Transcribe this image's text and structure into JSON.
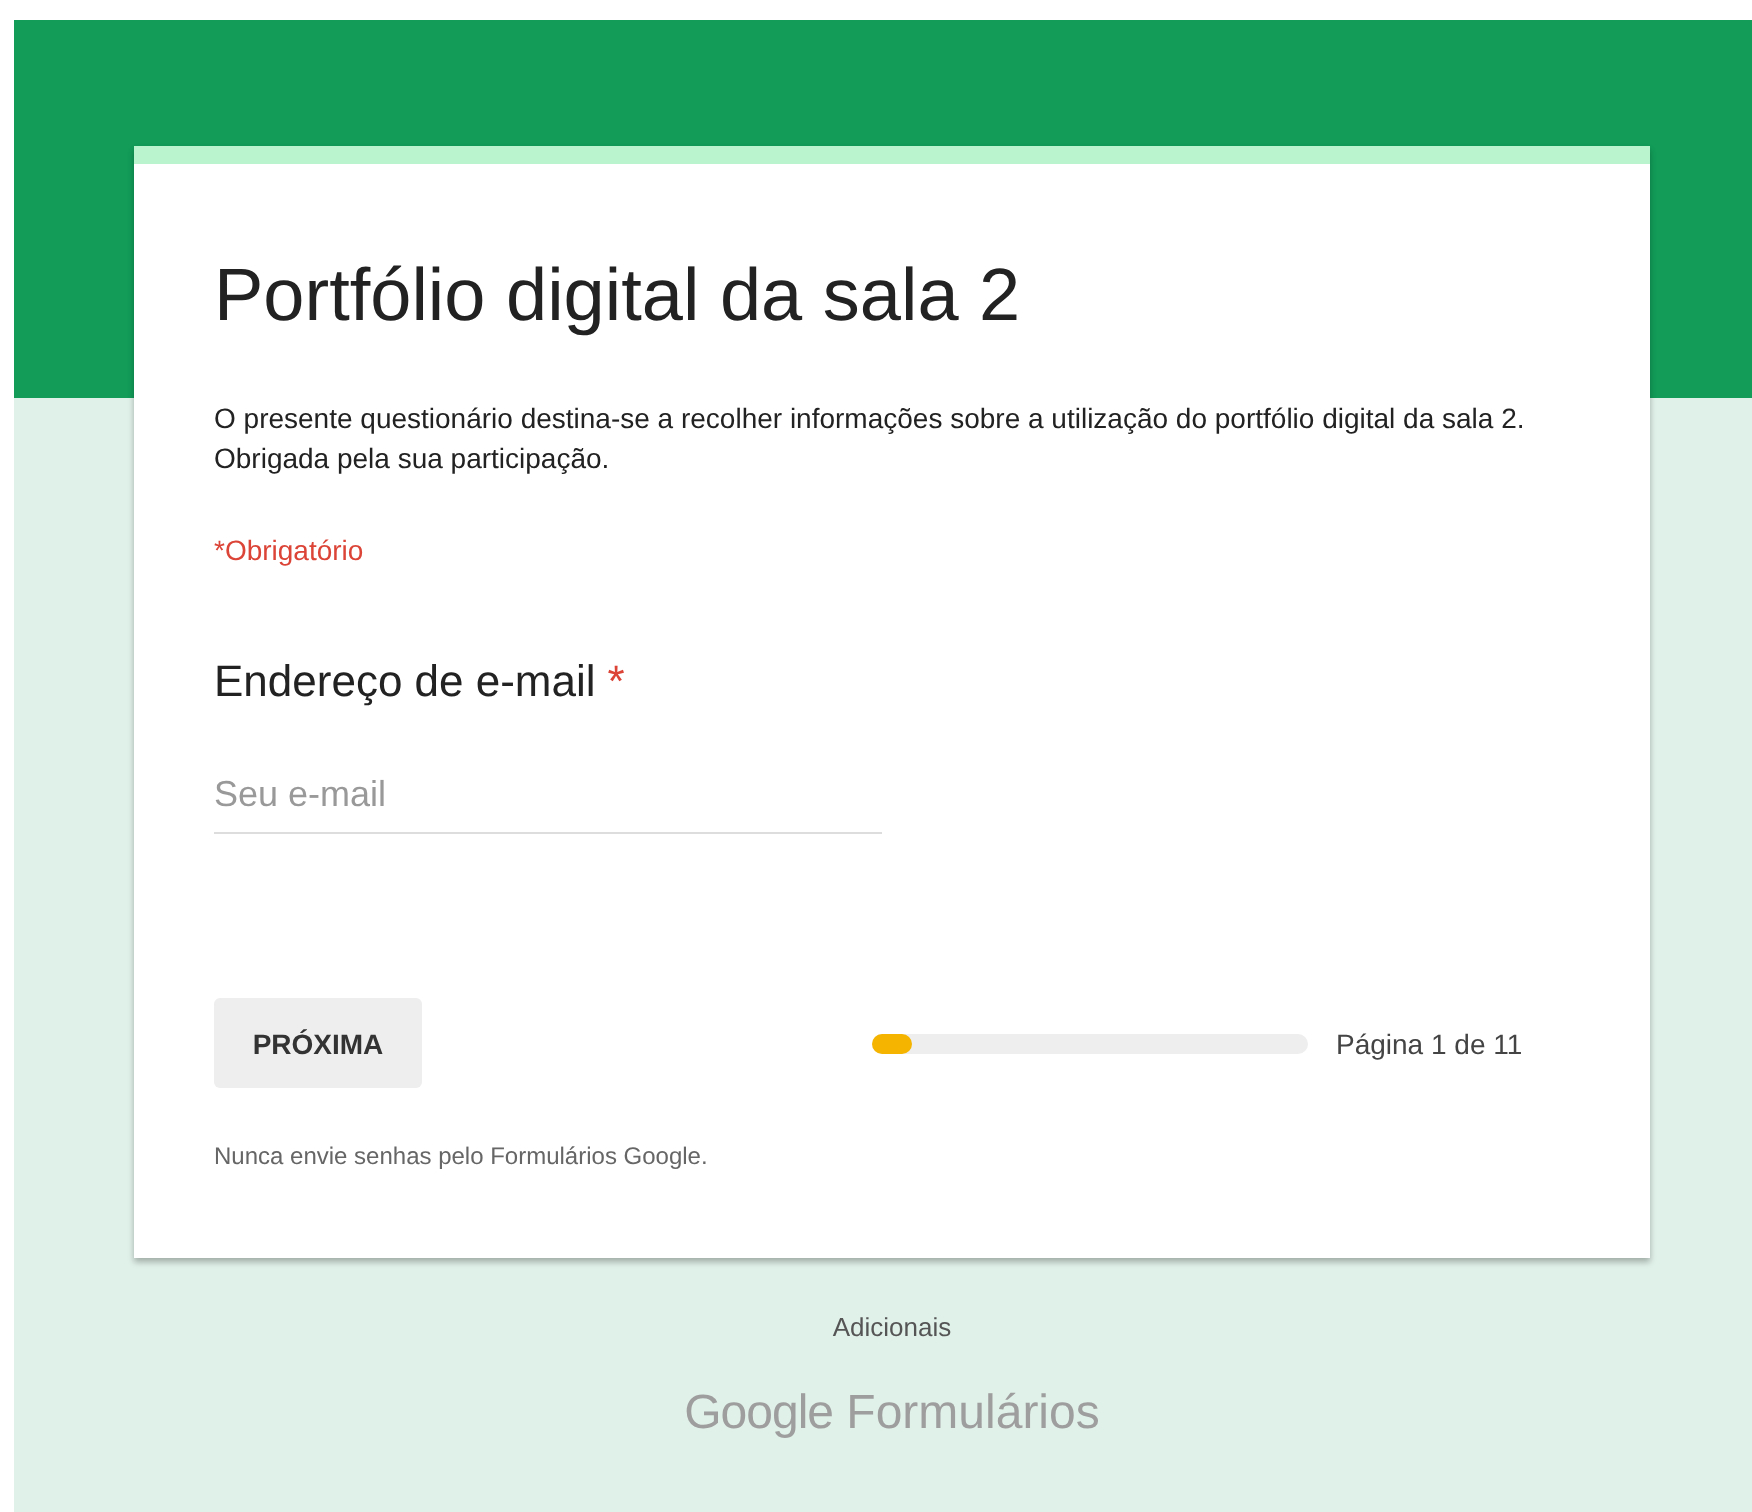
{
  "form": {
    "title": "Portfólio digital da sala 2",
    "description": "O presente questionário destina-se a recolher informações sobre a utilização do portfólio digital da sala 2. Obrigada pela sua participação.",
    "required_note": "*Obrigatório",
    "question": {
      "label": "Endereço de e-mail",
      "required_mark": "*",
      "placeholder": "Seu e-mail"
    },
    "next_button": "PRÓXIMA",
    "progress": {
      "level": 0.09,
      "label": "Página 1 de 11"
    },
    "warning": "Nunca envie senhas pelo Formulários Google."
  },
  "footer": {
    "text": "Adicionais",
    "logo_brand": "Google",
    "logo_product": "Formulários"
  }
}
